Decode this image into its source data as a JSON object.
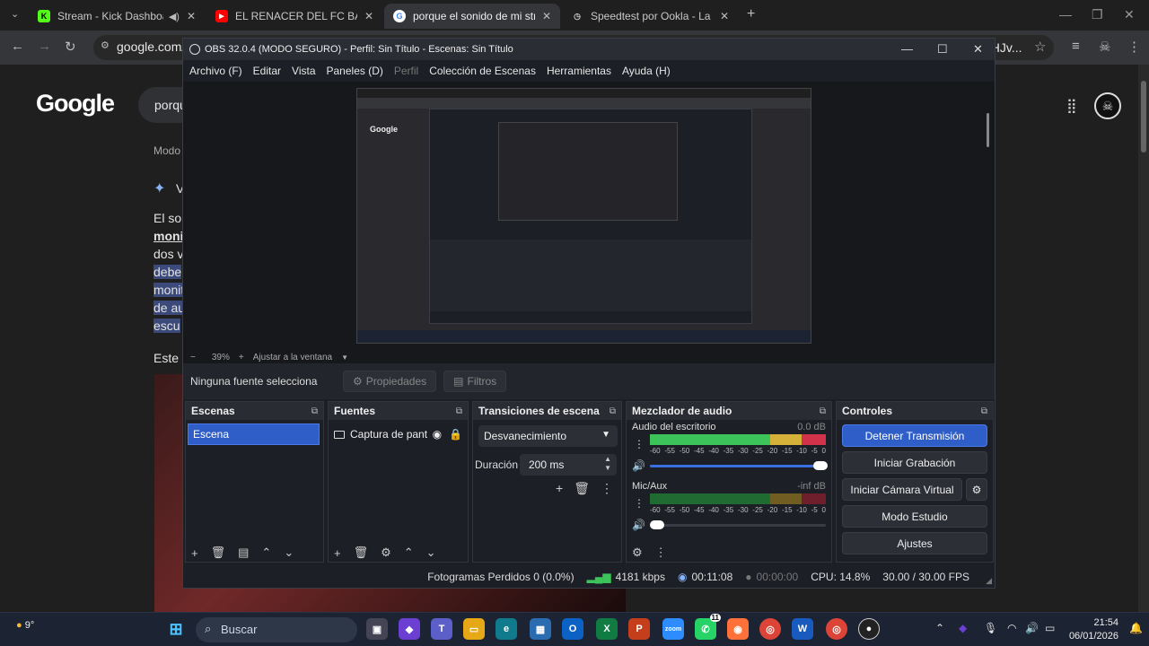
{
  "browser": {
    "tabs": [
      {
        "title": "Stream - Kick Dashboard",
        "favicon": "K",
        "favicon_color": "#53fc18"
      },
      {
        "title": "EL RENACER DEL FC BARCELONA",
        "favicon": "▶",
        "favicon_color": "#ff0000"
      },
      {
        "title": "porque el sonido de mi stream",
        "favicon": "G",
        "favicon_color": "#4285f4"
      },
      {
        "title": "Speedtest por Ookla - La prueba",
        "favicon": "◷",
        "favicon_color": "#888888"
      }
    ],
    "url": "google.com/s",
    "url_right": "aHJv..."
  },
  "google": {
    "logo": "Google",
    "search_query": "porqu",
    "mode_label": "Modo",
    "ai_label": "V",
    "lines": [
      "El so",
      "moni",
      "dos v",
      "debe",
      "monit",
      "de au",
      "escu"
    ],
    "this_label": "Este v"
  },
  "obs": {
    "title": "OBS 32.0.4 (MODO SEGURO) - Perfil: Sin Título - Escenas: Sin Título",
    "menu": [
      "Archivo (F)",
      "Editar",
      "Vista",
      "Paneles (D)",
      "Perfil",
      "Colección de Escenas",
      "Herramientas",
      "Ayuda (H)"
    ],
    "zoom": {
      "minus": "−",
      "value": "39%",
      "plus": "+",
      "fit": "Ajustar a la ventana"
    },
    "source_bar": {
      "none_selected": "Ninguna fuente selecciona",
      "properties": "Propiedades",
      "filters": "Filtros"
    },
    "docks": {
      "scenes": {
        "title": "Escenas",
        "items": [
          "Escena"
        ]
      },
      "sources": {
        "title": "Fuentes",
        "items": [
          "Captura de pant"
        ]
      },
      "transitions": {
        "title": "Transiciones de escena",
        "selected": "Desvanecimiento",
        "duration_label": "Duración",
        "duration_value": "200 ms"
      },
      "mixer": {
        "title": "Mezclador de audio",
        "tracks": [
          {
            "name": "Audio del escritorio",
            "db": "0.0 dB",
            "level": 0.98,
            "volume": 1.0
          },
          {
            "name": "Mic/Aux",
            "db": "-inf dB",
            "level": 0.0,
            "volume": 0.0
          }
        ],
        "scale": [
          "-60",
          "-55",
          "-50",
          "-45",
          "-40",
          "-35",
          "-30",
          "-25",
          "-20",
          "-15",
          "-10",
          "-5",
          "0"
        ]
      },
      "controls": {
        "title": "Controles",
        "stop_stream": "Detener Transmisión",
        "start_recording": "Iniciar Grabación",
        "start_virtual_cam": "Iniciar Cámara Virtual",
        "studio_mode": "Modo Estudio",
        "settings": "Ajustes"
      }
    },
    "status": {
      "dropped_frames": "Fotogramas Perdidos 0 (0.0%)",
      "bitrate": "4181 kbps",
      "stream_time": "00:11:08",
      "record_time": "00:00:00",
      "cpu": "CPU: 14.8%",
      "fps": "30.00 / 30.00 FPS"
    }
  },
  "preview": {
    "google_logo": "Google"
  },
  "taskbar": {
    "weather": "9°",
    "search_placeholder": "Buscar",
    "whatsapp_badge": "11",
    "time": "21:54",
    "date": "06/01/2026"
  },
  "colors": {
    "accent_blue": "#2f5ec8",
    "meter_green": "#3cc45a",
    "meter_yellow": "#d6b13a",
    "meter_red": "#d2334a"
  }
}
